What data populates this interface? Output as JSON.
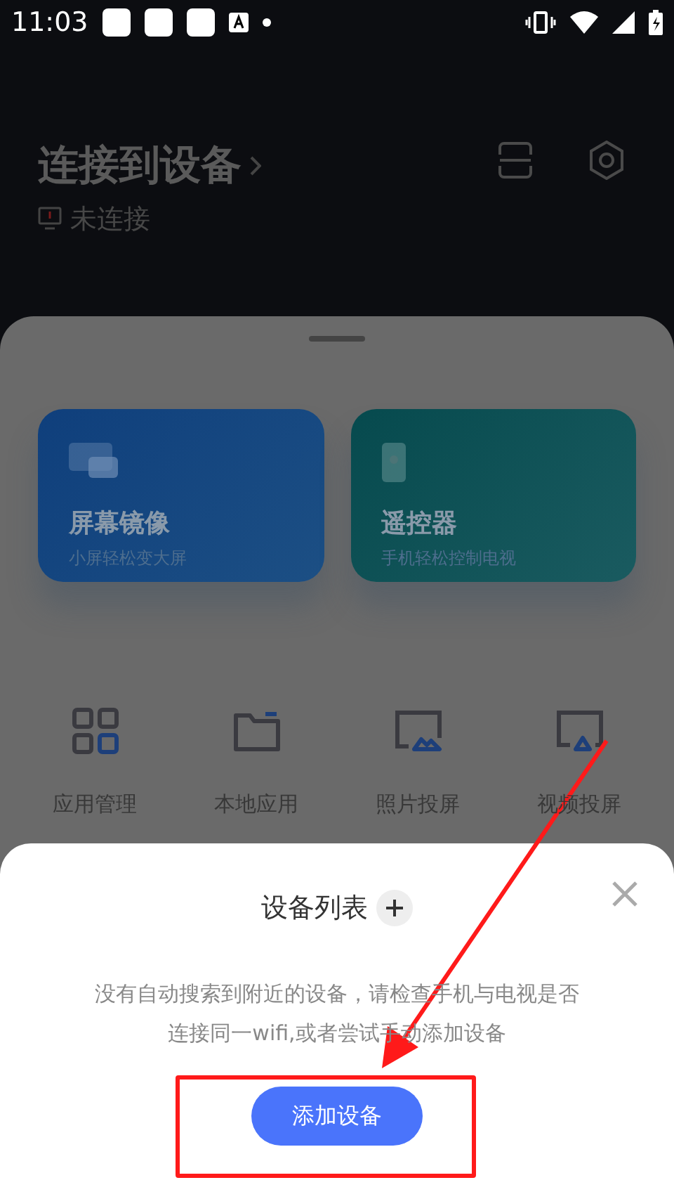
{
  "status_bar": {
    "time": "11:03"
  },
  "header": {
    "title": "连接到设备",
    "status": "未连接"
  },
  "cards": [
    {
      "kind": "mirror",
      "title": "屏幕镜像",
      "subtitle": "小屏轻松变大屏"
    },
    {
      "kind": "remote",
      "title": "遥控器",
      "subtitle": "手机轻松控制电视"
    }
  ],
  "tools": [
    {
      "kind": "apps",
      "label": "应用管理"
    },
    {
      "kind": "folder",
      "label": "本地应用"
    },
    {
      "kind": "photo",
      "label": "照片投屏"
    },
    {
      "kind": "video",
      "label": "视频投屏"
    }
  ],
  "dialog": {
    "title": "设备列表",
    "message": "没有自动搜索到附近的设备，请检查手机与电视是否连接同一wifi,或者尝试手动添加设备",
    "button": "添加设备"
  }
}
